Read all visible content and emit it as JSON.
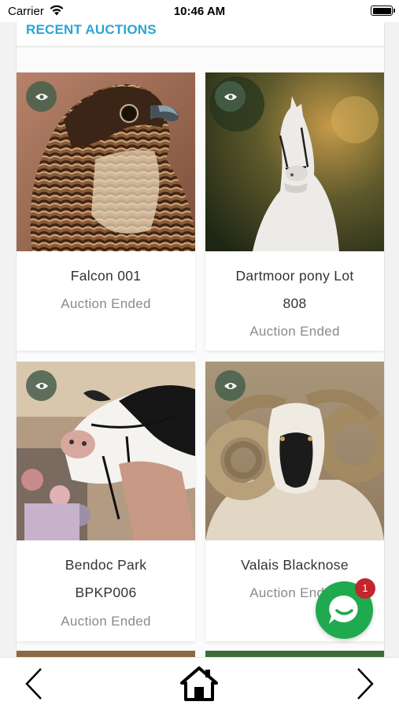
{
  "status_bar": {
    "carrier": "Carrier",
    "time": "10:46 AM",
    "wifi_icon": "wifi-icon",
    "battery_icon": "battery-icon"
  },
  "section": {
    "title": "RECENT AUCTIONS",
    "title_color": "#2aa5d6"
  },
  "auctions": [
    {
      "title_lines": [
        "Falcon 001"
      ],
      "status": "Auction Ended",
      "image": "falcon-photo",
      "view_icon": "eye-icon"
    },
    {
      "title_lines": [
        "Dartmoor pony Lot",
        "808"
      ],
      "status": "Auction Ended",
      "image": "white-horse-photo",
      "view_icon": "eye-icon"
    },
    {
      "title_lines": [
        "Bendoc Park",
        "BPKP006"
      ],
      "status": "Auction Ended",
      "image": "holstein-cow-photo",
      "view_icon": "eye-icon"
    },
    {
      "title_lines": [
        "Valais Blacknose"
      ],
      "status": "Auction Ended",
      "image": "blacknose-ram-photo",
      "view_icon": "eye-icon"
    }
  ],
  "chat": {
    "icon": "chat-bubble-icon",
    "unread_count": "1",
    "color": "#1faa4f",
    "badge_color": "#c1272d"
  },
  "bottom_nav": {
    "back_icon": "chevron-left-icon",
    "home_icon": "home-icon",
    "forward_icon": "chevron-right-icon"
  }
}
